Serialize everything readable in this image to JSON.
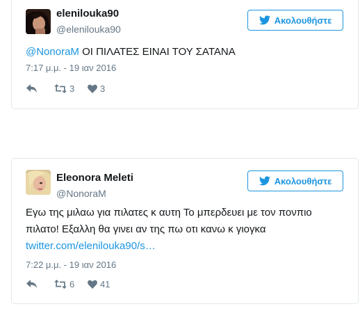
{
  "tweets": [
    {
      "name": "elenilouka90",
      "handle": "@elenilouka90",
      "follow_label": "Ακολουθήστε",
      "mention": "@NonoraM",
      "text": " ΟΙ ΠΙΛΑΤΕΣ ΕΙΝΑΙ ΤΟΥ ΣΑΤΑΝΑ",
      "timestamp": "7:17 μ.μ. - 19 ιαν 2016",
      "retweets": "3",
      "likes": "3",
      "icons": {
        "reply": "reply-icon",
        "retweet": "retweet-icon",
        "like": "heart-icon",
        "follow": "twitter-bird-icon"
      }
    },
    {
      "name": "Eleonora Meleti",
      "handle": "@NonoraM",
      "follow_label": "Ακολουθήστε",
      "text_line1": "Εγω της μιλαω για πιλατες κ αυτη Το μπερδευει με τον πονπιο",
      "text_line2": "πιλατο! Εξαλλη θα γινει αν της πω οτι κανω κ γιογκα",
      "link": "twitter.com/elenilouka90/s…",
      "timestamp": "7:22 μ.μ. - 19 ιαν 2016",
      "retweets": "6",
      "likes": "41",
      "icons": {
        "reply": "reply-icon",
        "retweet": "retweet-icon",
        "like": "heart-icon",
        "follow": "twitter-bird-icon"
      }
    }
  ],
  "colors": {
    "accent": "#1b95e0",
    "muted": "#657786",
    "text": "#14171a",
    "border": "#e1e8ed"
  }
}
